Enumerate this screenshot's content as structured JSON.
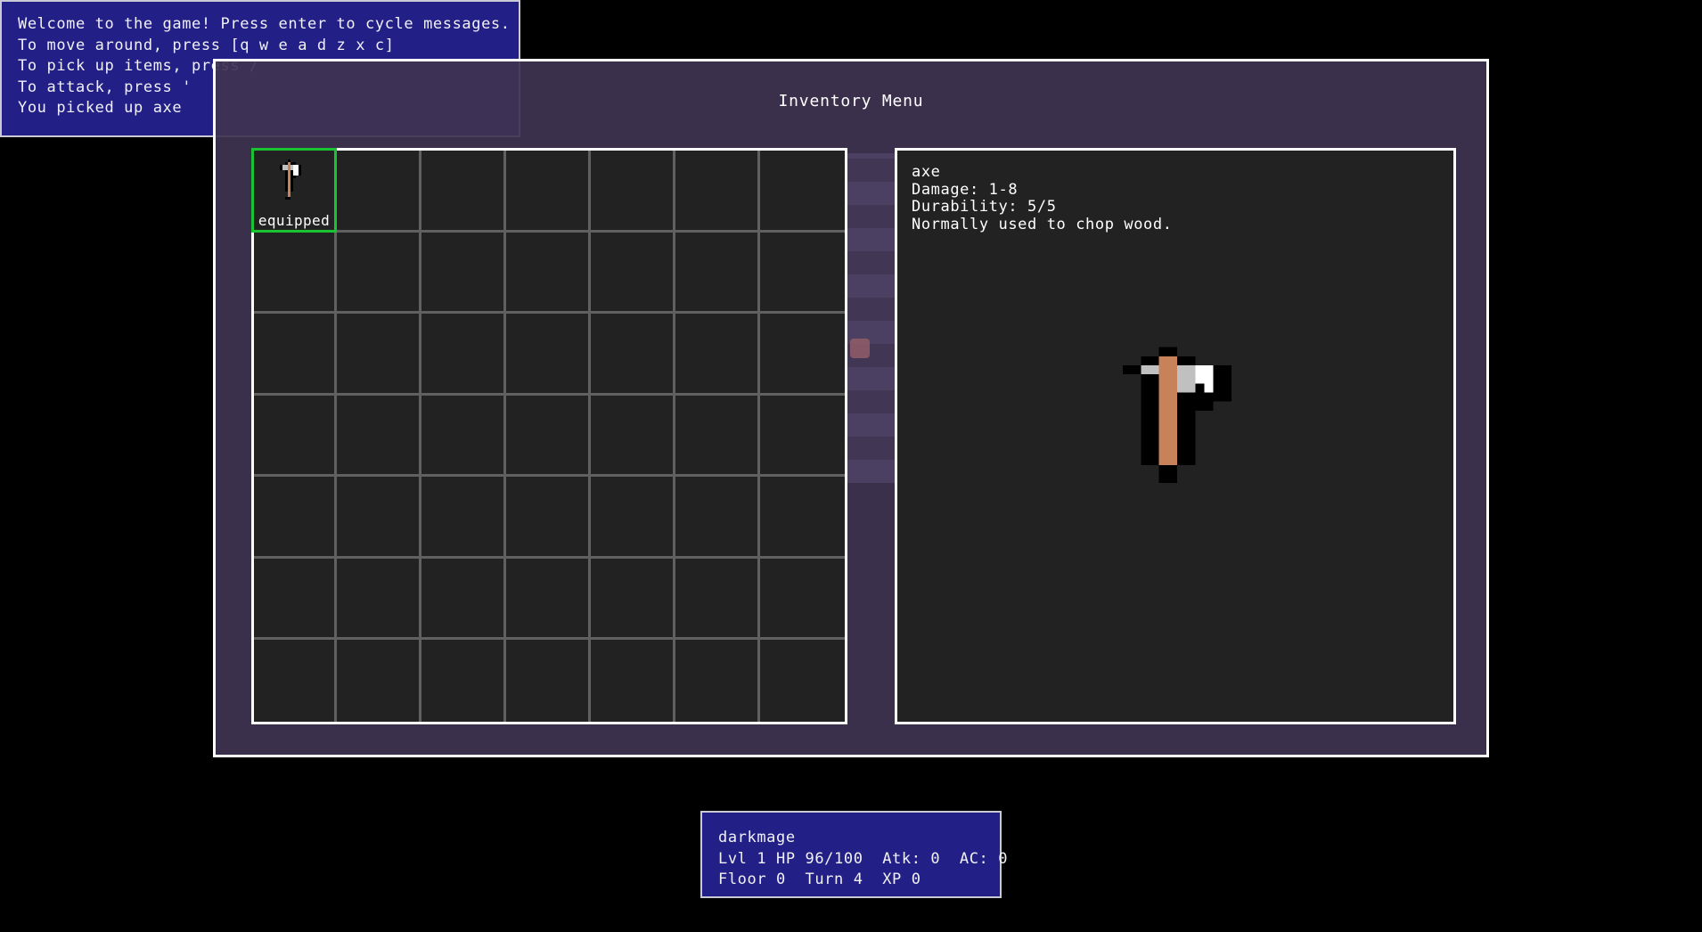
{
  "message_log": {
    "lines": [
      "Welcome to the game! Press enter to cycle messages.",
      "To move around, press [q w e a d z x c]",
      "To pick up items, press /",
      "To attack, press '",
      "You picked up axe"
    ]
  },
  "inventory": {
    "title": "Inventory Menu",
    "columns": 7,
    "rows": 7,
    "slots": [
      {
        "item": "axe",
        "icon": "axe-icon",
        "label": "equipped",
        "selected": true
      }
    ]
  },
  "detail": {
    "name": "axe",
    "damage": "Damage: 1-8",
    "durability": "Durability: 5/5",
    "description": "Normally used to chop wood.",
    "icon": "axe-icon"
  },
  "status": {
    "name": "darkmage",
    "line1": "Lvl 1 HP 96/100  Atk: 0  AC: 0",
    "line2": "Floor 0  Turn 4  XP 0"
  },
  "colors": {
    "panel_blue": "#221f86",
    "inventory_bg": "#403452",
    "slot_bg": "#222222",
    "grid_line": "#606060",
    "selected": "#19c331",
    "axe_handle": "#c8825a",
    "axe_blade": "#c0c0c0"
  }
}
